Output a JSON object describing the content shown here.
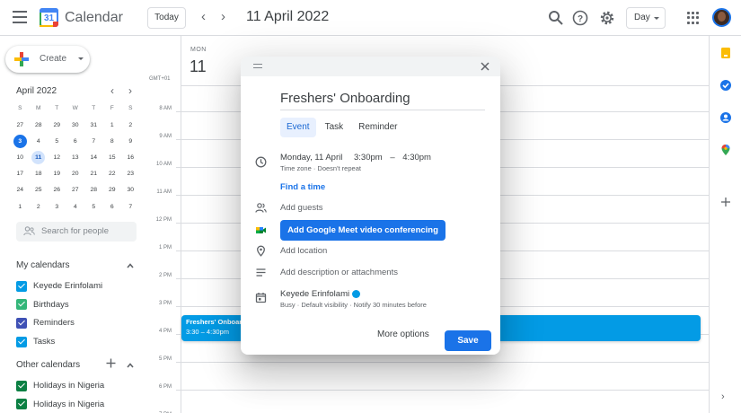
{
  "header": {
    "app_title": "Calendar",
    "logo_day": "31",
    "today_label": "Today",
    "date_title": "11 April 2022",
    "view_label": "Day"
  },
  "sidebar": {
    "create_label": "Create",
    "mini_calendar": {
      "title": "April 2022",
      "weekdays": [
        "S",
        "M",
        "T",
        "W",
        "T",
        "F",
        "S"
      ],
      "weeks": [
        [
          "27",
          "28",
          "29",
          "30",
          "31",
          "1",
          "2"
        ],
        [
          "3",
          "4",
          "5",
          "6",
          "7",
          "8",
          "9"
        ],
        [
          "10",
          "11",
          "12",
          "13",
          "14",
          "15",
          "16"
        ],
        [
          "17",
          "18",
          "19",
          "20",
          "21",
          "22",
          "23"
        ],
        [
          "24",
          "25",
          "26",
          "27",
          "28",
          "29",
          "30"
        ],
        [
          "1",
          "2",
          "3",
          "4",
          "5",
          "6",
          "7"
        ]
      ],
      "today": "3",
      "selected": "11"
    },
    "search_placeholder": "Search for people",
    "my_calendars_title": "My calendars",
    "my_calendars": [
      {
        "label": "Keyede Erinfolami",
        "color": "#039be5"
      },
      {
        "label": "Birthdays",
        "color": "#33b679"
      },
      {
        "label": "Reminders",
        "color": "#3f51b5"
      },
      {
        "label": "Tasks",
        "color": "#039be5"
      }
    ],
    "other_calendars_title": "Other calendars",
    "other_calendars": [
      {
        "label": "Holidays in Nigeria",
        "color": "#0b8043"
      },
      {
        "label": "Holidays in Nigeria",
        "color": "#0b8043"
      }
    ]
  },
  "day_view": {
    "weekday": "MON",
    "day_number": "11",
    "timezone": "GMT+01",
    "hours": [
      "8 AM",
      "9 AM",
      "10 AM",
      "11 AM",
      "12 PM",
      "1 PM",
      "2 PM",
      "3 PM",
      "4 PM",
      "5 PM",
      "6 PM",
      "7 PM"
    ],
    "event": {
      "title": "Freshers' Onboard",
      "time": "3:30 – 4:30pm",
      "color": "#039be5"
    }
  },
  "dialog": {
    "title": "Freshers' Onboarding",
    "tabs": [
      "Event",
      "Task",
      "Reminder"
    ],
    "active_tab": "Event",
    "date": "Monday, 11 April",
    "start_time": "3:30pm",
    "dash": "–",
    "end_time": "4:30pm",
    "timezone_note": "Time zone · Doesn't repeat",
    "find_time": "Find a time",
    "add_guests": "Add guests",
    "meet_button": "Add Google Meet video conferencing",
    "add_location": "Add location",
    "add_description": "Add description or attachments",
    "owner": "Keyede Erinfolami",
    "owner_details": "Busy · Default visibility · Notify 30 minutes before",
    "more_options": "More options",
    "save": "Save"
  },
  "colors": {
    "accent": "#1a73e8",
    "event": "#039be5"
  }
}
